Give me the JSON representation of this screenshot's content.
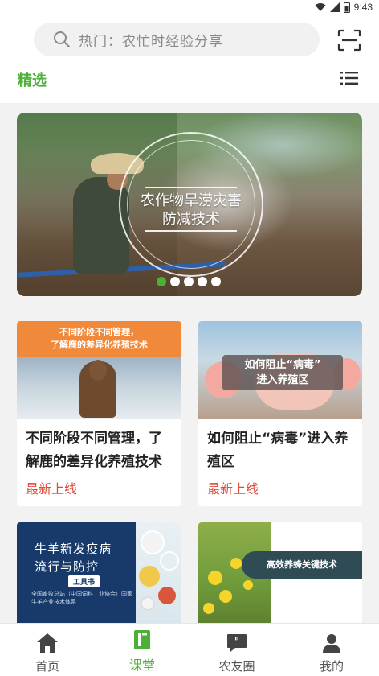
{
  "status_bar": {
    "time": "9:43",
    "icons": [
      "wifi-icon",
      "signal-icon",
      "battery-icon"
    ]
  },
  "header": {
    "search_placeholder": "热门：农忙时经验分享",
    "tab_selected": "精选",
    "icons": [
      "search-icon",
      "scan-icon",
      "list-icon"
    ]
  },
  "banner": {
    "title_line1": "农作物旱涝灾害",
    "title_line2": "防减技术",
    "slide_count": 5,
    "active_slide": 1
  },
  "cards": [
    {
      "thumb_text_line1": "不同阶段不同管理，",
      "thumb_text_line2": "了解鹿的差异化养殖技术",
      "title": "不同阶段不同管理，了解鹿的差异化养殖技术",
      "tag": "最新上线"
    },
    {
      "thumb_text_line1": "如何阻止“病毒”",
      "thumb_text_line2": "进入养殖区",
      "title": "如何阻止“病毒”进入养殖区",
      "tag": "最新上线"
    },
    {
      "thumb_title_line1": "牛羊新发疫病",
      "thumb_title_line2": "流行与防控",
      "thumb_badge": "工具书",
      "thumb_small": "全国畜牧总站（中国饲料工业协会）国家牛羊产业技术体系"
    },
    {
      "thumb_label": "高效养蜂关键技术"
    }
  ],
  "bottom_nav": [
    {
      "label": "首页",
      "icon": "home-icon",
      "active": false
    },
    {
      "label": "课堂",
      "icon": "book-icon",
      "active": true
    },
    {
      "label": "农友圈",
      "icon": "chat-quote-icon",
      "active": false
    },
    {
      "label": "我的",
      "icon": "user-icon",
      "active": false
    }
  ],
  "colors": {
    "accent": "#4caf36",
    "tag_red": "#e04b3a",
    "background": "#f2f2f2"
  }
}
